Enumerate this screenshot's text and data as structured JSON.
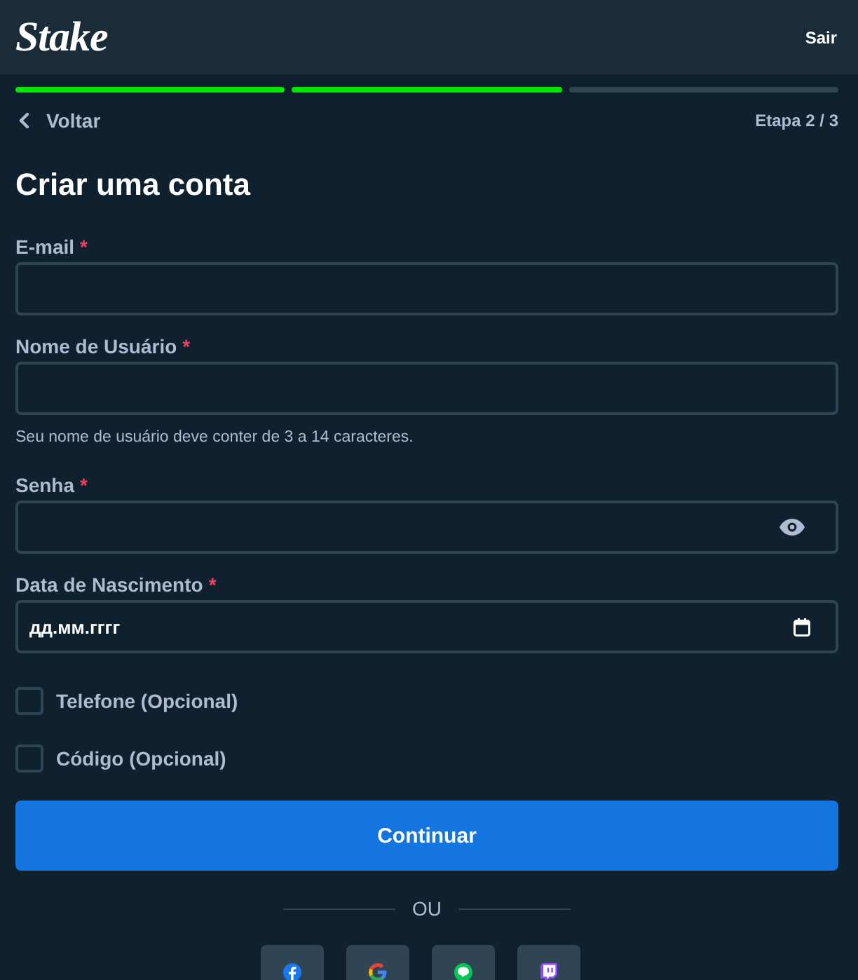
{
  "header": {
    "logo": "Stake",
    "exit_link": "Sair"
  },
  "progress_steps": [
    {
      "complete": true
    },
    {
      "complete": true
    },
    {
      "complete": false
    }
  ],
  "nav": {
    "back_label": "Voltar",
    "step_label": "Etapa 2 / 3"
  },
  "title": "Criar uma conta",
  "fields": [
    {
      "kind": "text",
      "label": "E-mail",
      "required_mark": "*"
    },
    {
      "kind": "text",
      "label": "Nome de Usuário",
      "required_mark": "*",
      "hint": "Seu nome de usuário deve conter de 3 a 14 caracteres."
    },
    {
      "kind": "password",
      "label": "Senha",
      "required_mark": "*"
    },
    {
      "kind": "date",
      "label": "Data de Nascimento",
      "required_mark": "*",
      "placeholder": "дд.мм.гггг"
    }
  ],
  "options": [
    {
      "label": "Telefone (Opcional)",
      "checked": false
    },
    {
      "label": "Código (Opcional)",
      "checked": false
    }
  ],
  "submit_button": "Continuar",
  "divider_label": "OU",
  "social_buttons": [
    {
      "kind": "facebook"
    },
    {
      "kind": "google"
    },
    {
      "kind": "line"
    },
    {
      "kind": "twitch"
    }
  ]
}
